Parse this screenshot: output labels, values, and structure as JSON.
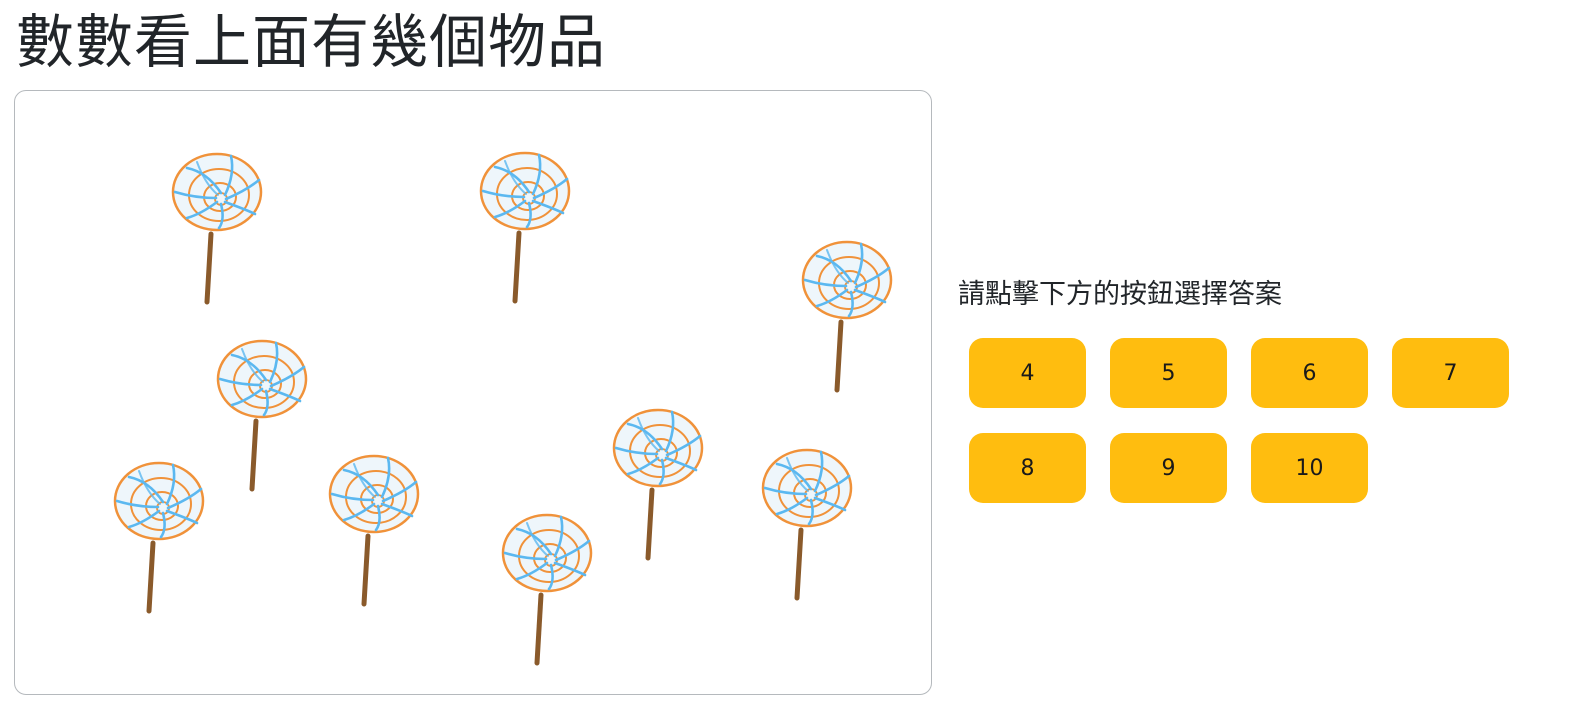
{
  "title": "數數看上面有幾個物品",
  "board": {
    "item_icon": "lollipop-icon",
    "item_count": 9,
    "colors": {
      "swirl_outline": "#f0923a",
      "swirl_stripe": "#5bb8f0",
      "candy_fill": "#eef6fb",
      "stick": "#8a5a2b"
    }
  },
  "prompt": "請點擊下方的按鈕選擇答案",
  "answers": [
    {
      "label": "4"
    },
    {
      "label": "5"
    },
    {
      "label": "6"
    },
    {
      "label": "7"
    },
    {
      "label": "8"
    },
    {
      "label": "9"
    },
    {
      "label": "10"
    }
  ],
  "button_color": "#ffbd0f"
}
